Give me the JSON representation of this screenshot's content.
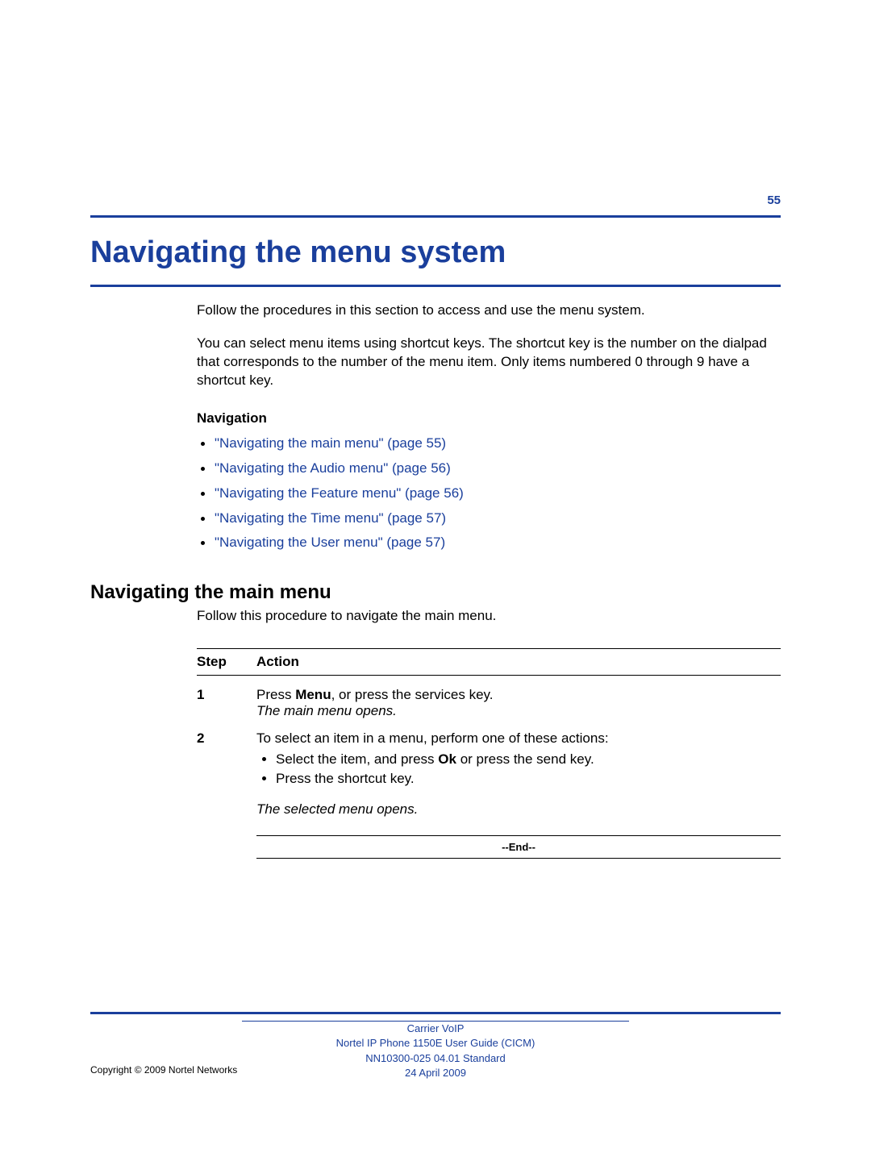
{
  "page_number": "55",
  "title": "Navigating the menu system",
  "intro_para_1": "Follow the procedures in this section to access and use the menu system.",
  "intro_para_2": "You can select menu items using shortcut keys. The shortcut key is the number on the dialpad that corresponds to the number of the menu item. Only items numbered 0 through 9 have a shortcut key.",
  "nav_label": "Navigation",
  "nav_links": [
    "\"Navigating the main menu\" (page 55)",
    "\"Navigating the Audio menu\" (page 56)",
    "\"Navigating the Feature menu\" (page 56)",
    "\"Navigating the Time menu\" (page 57)",
    "\"Navigating the User menu\" (page 57)"
  ],
  "section_heading": "Navigating the main menu",
  "section_intro": "Follow this procedure to navigate the main menu.",
  "table": {
    "col_step": "Step",
    "col_action": "Action",
    "rows": [
      {
        "num": "1",
        "line1_pre": "Press ",
        "line1_bold": "Menu",
        "line1_post": ", or press the services key.",
        "result": "The main menu opens."
      },
      {
        "num": "2",
        "intro": "To select an item in a menu, perform one of these actions:",
        "bullet1_pre": "Select the item, and press ",
        "bullet1_bold": "Ok",
        "bullet1_post": " or press the send key.",
        "bullet2": "Press the shortcut key.",
        "result": "The selected menu opens."
      }
    ],
    "end": "--End--"
  },
  "footer": {
    "line1": "Carrier VoIP",
    "line2": "Nortel IP Phone 1150E User Guide (CICM)",
    "line3": "NN10300-025   04.01   Standard",
    "line4": "24 April 2009"
  },
  "copyright": "Copyright © 2009 Nortel Networks"
}
